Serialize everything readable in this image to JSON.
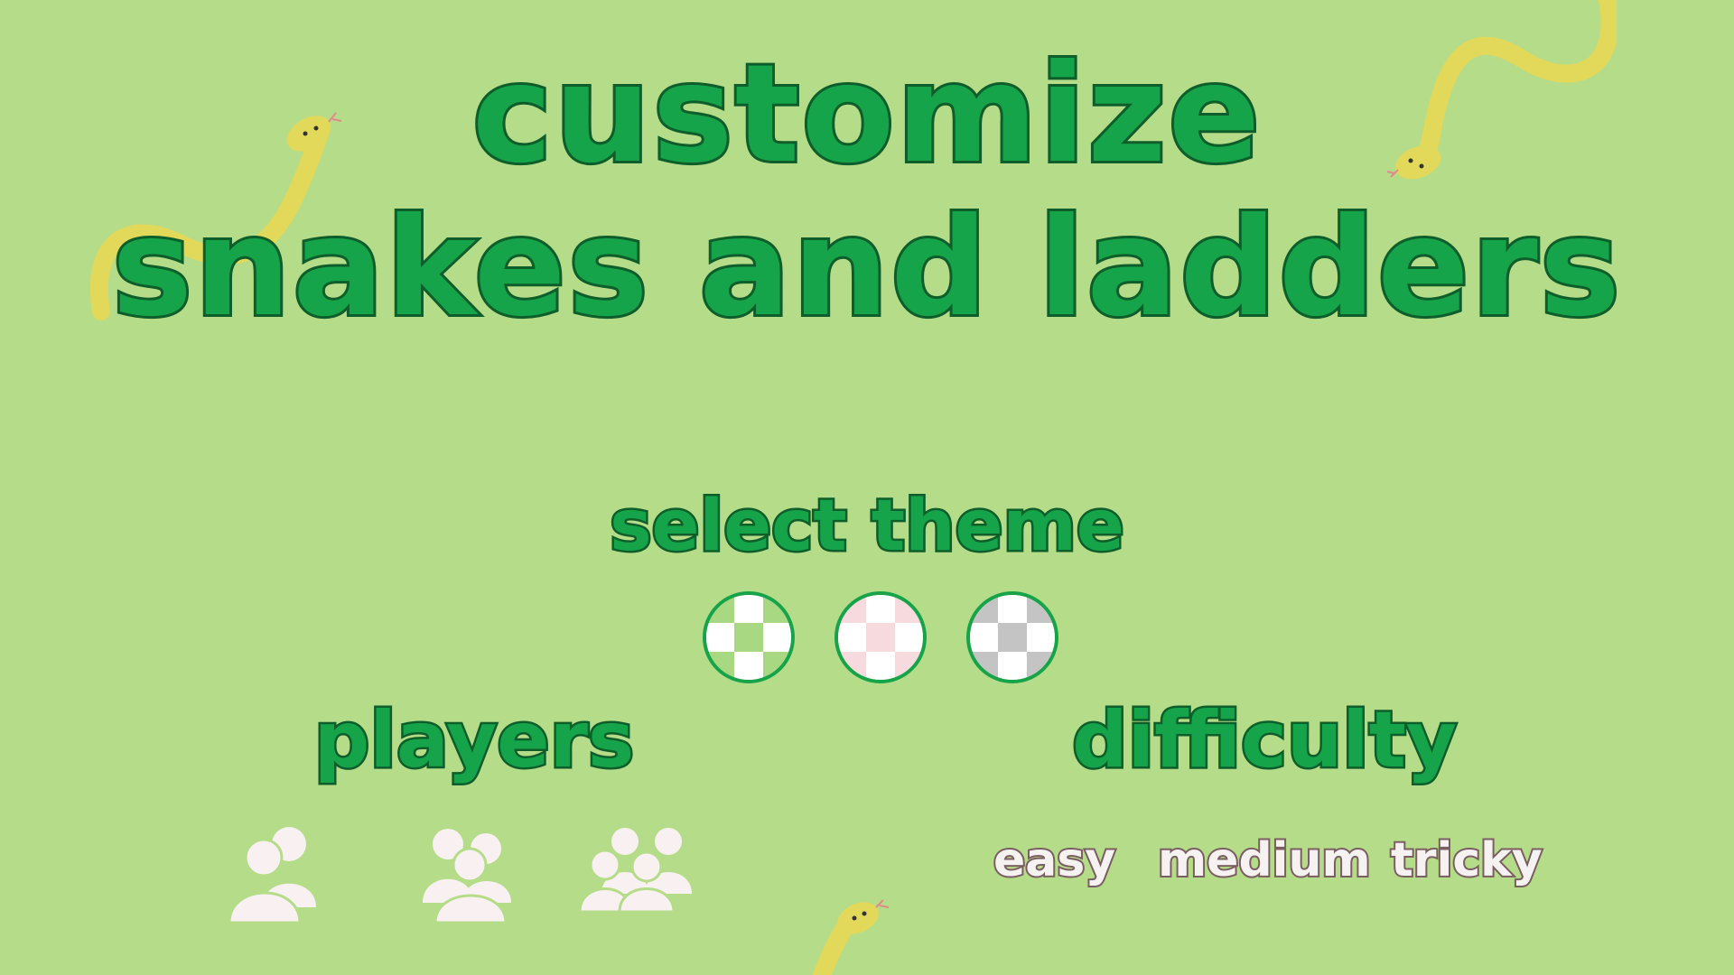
{
  "title": {
    "line1": "customize",
    "line2": "snakes and ladders"
  },
  "theme": {
    "heading": "select theme",
    "options": [
      {
        "name": "green",
        "light": "#ffffff",
        "dark": "#a8d882"
      },
      {
        "name": "pink",
        "light": "#ffffff",
        "dark": "#f6dadd"
      },
      {
        "name": "grey",
        "light": "#ffffff",
        "dark": "#c4c4c4"
      }
    ]
  },
  "players": {
    "heading": "players",
    "options": [
      "two-players-icon",
      "three-players-icon",
      "four-players-icon"
    ]
  },
  "difficulty": {
    "heading": "difficulty",
    "options": [
      "easy",
      "medium",
      "tricky"
    ]
  },
  "colors": {
    "background": "#b5dc88",
    "title_fill": "#16a44a",
    "title_outline": "#0d5e2a",
    "snake": "#e2d95a",
    "option_text": "#f7f2f2"
  }
}
